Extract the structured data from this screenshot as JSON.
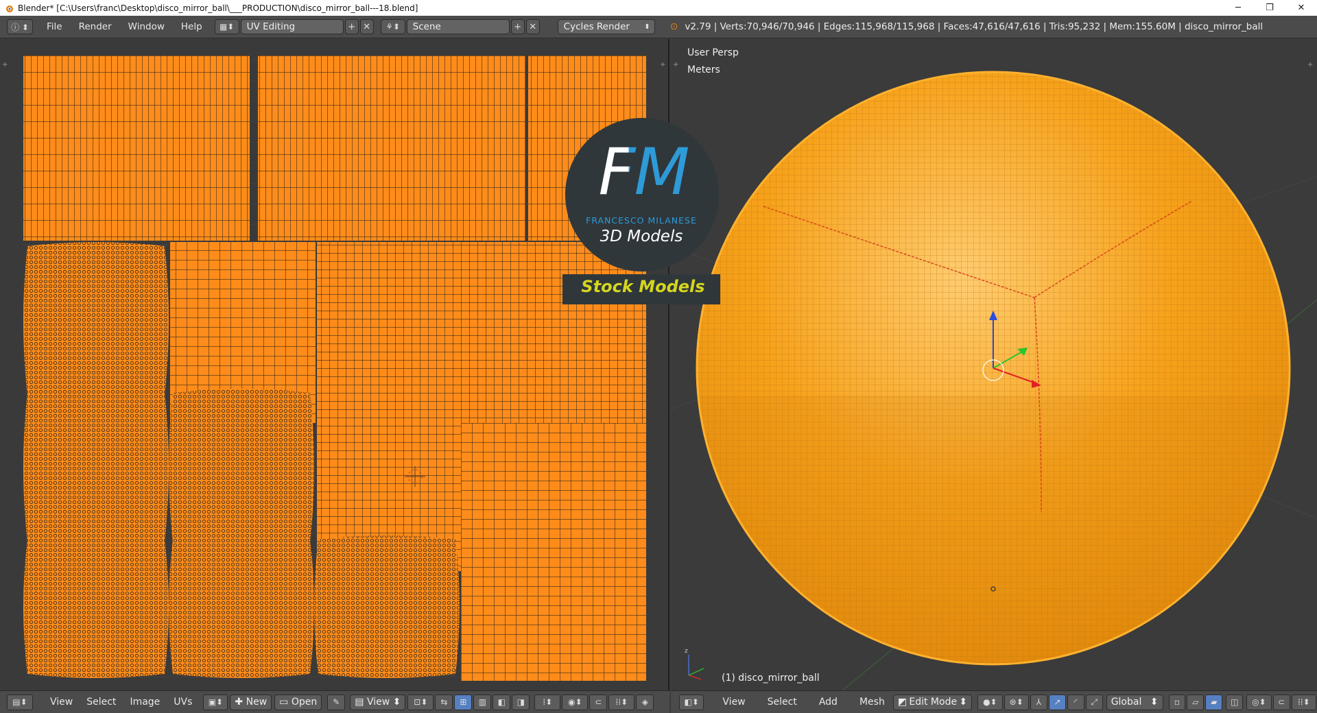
{
  "window": {
    "title": "Blender* [C:\\Users\\franc\\Desktop\\disco_mirror_ball\\___PRODUCTION\\disco_mirror_ball---18.blend]",
    "minimize": "─",
    "maximize": "❐",
    "close": "✕"
  },
  "info_header": {
    "menus": [
      "File",
      "Render",
      "Window",
      "Help"
    ],
    "layout": "UV Editing",
    "scene": "Scene",
    "engine": "Cycles Render",
    "stats": "v2.79 | Verts:70,946/70,946 | Edges:115,968/115,968 | Faces:47,616/47,616 | Tris:95,232 | Mem:155.60M | disco_mirror_ball"
  },
  "uv_footer": {
    "menus": [
      "View",
      "Select",
      "Image",
      "UVs"
    ],
    "new_label": "New",
    "open_label": "Open",
    "view_label": "View"
  },
  "viewport": {
    "persp": "User Persp",
    "units": "Meters",
    "object": "(1) disco_mirror_ball"
  },
  "v3d_footer": {
    "menus": [
      "View",
      "Select",
      "Add",
      "Mesh"
    ],
    "mode": "Edit Mode",
    "orientation": "Global"
  },
  "logo": {
    "letters": "FM",
    "company": "FRANCESCO MILANESE",
    "subtitle": "3D Models",
    "banner": "Stock Models"
  },
  "colors": {
    "uv_orange": "#ff8c1a",
    "sphere_orange": "#f7a21b",
    "accent_blue": "#5680c2"
  }
}
